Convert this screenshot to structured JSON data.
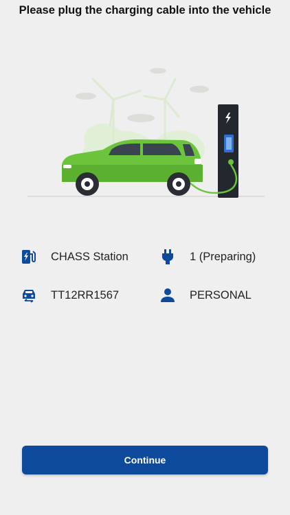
{
  "header": {
    "title": "Please plug the charging cable into the vehicle"
  },
  "info": {
    "station": {
      "icon": "charging-station-icon",
      "label": "CHASS Station"
    },
    "connector": {
      "icon": "plug-icon",
      "label": "1 (Preparing)"
    },
    "vehicle": {
      "icon": "car-icon",
      "label": "TT12RR1567"
    },
    "account": {
      "icon": "person-icon",
      "label": "PERSONAL"
    }
  },
  "footer": {
    "continue_label": "Continue"
  },
  "colors": {
    "accent": "#0d4a9c",
    "icon": "#0d4a9c",
    "car": "#6cc43c"
  }
}
